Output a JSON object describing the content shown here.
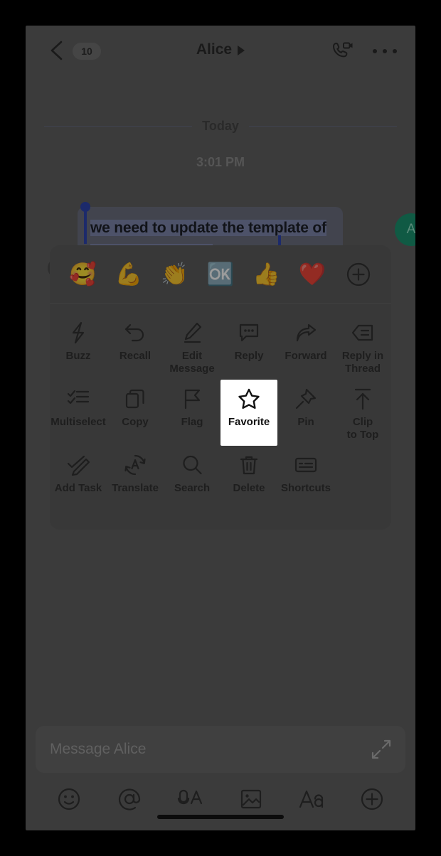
{
  "app": {
    "platform": "mobile-chat",
    "theme_bg": "#3b3b3b",
    "accent": "#1c2a6b",
    "avatar_color": "#105a44",
    "selected_tile_bg": "#ffffff"
  },
  "navbar": {
    "back_icon": "chevron-left-icon",
    "unread_count": "10",
    "title": "Alice",
    "title_caret_icon": "caret-right-icon",
    "call_icon": "video-call-icon",
    "more_icon": "ellipsis-icon"
  },
  "conversation": {
    "date_label": "Today",
    "timestamp": "3:01 PM",
    "message": {
      "text": "we need to update the template of our weekly report",
      "selected_text": "we need to update the template of our weekly report",
      "avatar_initial": "A",
      "status_icon": "sending-spinner-icon"
    }
  },
  "context_menu": {
    "reactions": [
      {
        "name": "face-holding-back-tears-heart",
        "glyph": "🥰"
      },
      {
        "name": "flexed-biceps",
        "glyph": "💪"
      },
      {
        "name": "clapping-hands",
        "glyph": "👏"
      },
      {
        "name": "ok-sign",
        "glyph": "🆗"
      },
      {
        "name": "thumbs-up",
        "glyph": "👍"
      },
      {
        "name": "red-heart",
        "glyph": "❤️"
      }
    ],
    "add_reaction_icon": "plus-circle-icon",
    "actions": [
      [
        {
          "label": "Buzz",
          "icon": "lightning-bolt-icon",
          "selected": false
        },
        {
          "label": "Recall",
          "icon": "undo-arrow-icon",
          "selected": false
        },
        {
          "label": "Edit\nMessage",
          "icon": "pencil-edit-icon",
          "selected": false
        },
        {
          "label": "Reply",
          "icon": "speech-bubble-icon",
          "selected": false
        },
        {
          "label": "Forward",
          "icon": "forward-arrow-icon",
          "selected": false
        },
        {
          "label": "Reply in\nThread",
          "icon": "reply-thread-icon",
          "selected": false
        }
      ],
      [
        {
          "label": "Multiselect",
          "icon": "checklist-icon",
          "selected": false
        },
        {
          "label": "Copy",
          "icon": "copy-icon",
          "selected": false
        },
        {
          "label": "Flag",
          "icon": "flag-icon",
          "selected": false
        },
        {
          "label": "Favorite",
          "icon": "star-icon",
          "selected": true
        },
        {
          "label": "Pin",
          "icon": "pin-icon",
          "selected": false
        },
        {
          "label": "Clip\nto Top",
          "icon": "clip-to-top-icon",
          "selected": false
        }
      ],
      [
        {
          "label": "Add Task",
          "icon": "check-pencil-icon",
          "selected": false
        },
        {
          "label": "Translate",
          "icon": "translate-icon",
          "selected": false
        },
        {
          "label": "Search",
          "icon": "magnifier-icon",
          "selected": false
        },
        {
          "label": "Delete",
          "icon": "trash-icon",
          "selected": false
        },
        {
          "label": "Shortcuts",
          "icon": "shortcuts-icon",
          "selected": false
        },
        {
          "label": "",
          "icon": "",
          "selected": false
        }
      ]
    ]
  },
  "composer": {
    "placeholder": "Message Alice",
    "expand_icon": "expand-diagonal-icon",
    "tools": [
      {
        "name": "emoji-icon"
      },
      {
        "name": "mention-icon"
      },
      {
        "name": "voice-to-text-icon"
      },
      {
        "name": "image-icon"
      },
      {
        "name": "text-format-icon"
      },
      {
        "name": "add-more-icon"
      }
    ],
    "home_indicator": "home-indicator"
  }
}
